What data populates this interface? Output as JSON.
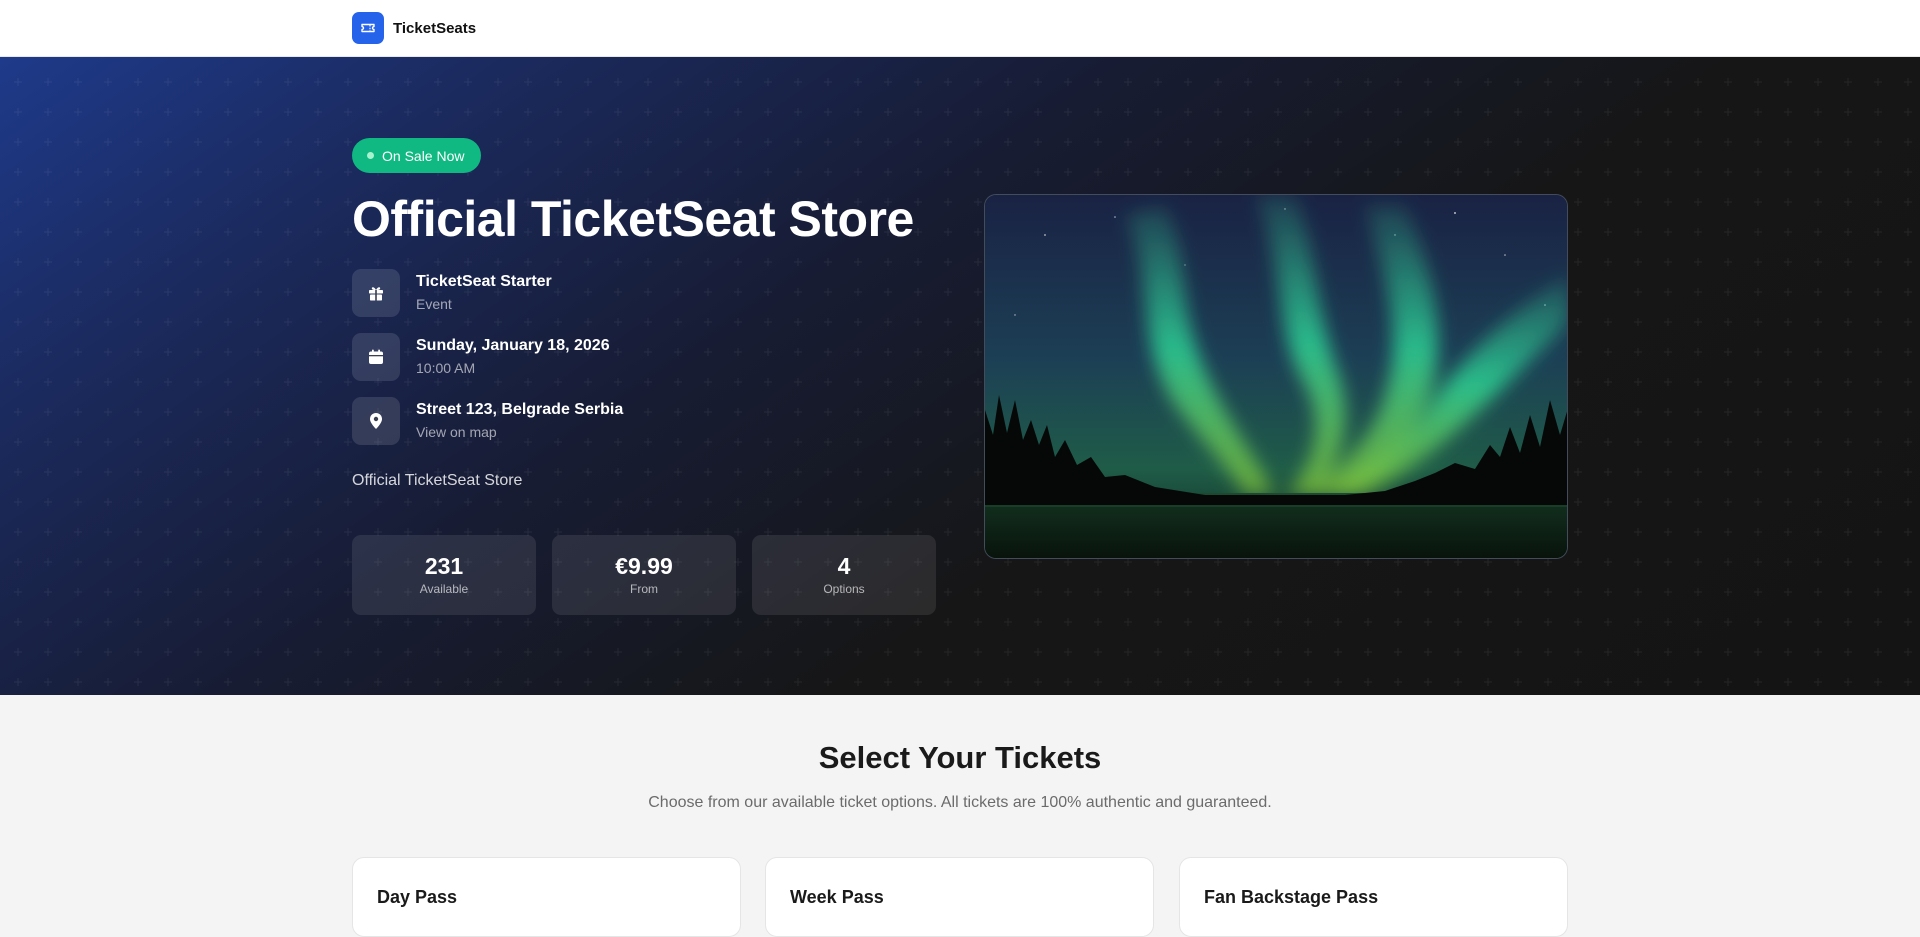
{
  "header": {
    "brand_name": "TicketSeats",
    "logo_icon": "ticket-icon",
    "logo_color": "#2563eb"
  },
  "hero": {
    "badge": "On Sale Now",
    "badge_color": "#10b981",
    "title": "Official TicketSeat Store",
    "info": [
      {
        "icon": "gift-icon",
        "main": "TicketSeat Starter",
        "sub": "Event"
      },
      {
        "icon": "calendar-icon",
        "main": "Sunday, January 18, 2026",
        "sub": "10:00 AM"
      },
      {
        "icon": "location-pin-icon",
        "main": "Street 123, Belgrade Serbia",
        "sub": "View on map"
      }
    ],
    "description": "Official TicketSeat Store",
    "stats": [
      {
        "value": "231",
        "label": "Available"
      },
      {
        "value": "€9.99",
        "label": "From"
      },
      {
        "value": "4",
        "label": "Options"
      }
    ],
    "image": "aurora-borealis-over-forest-lake"
  },
  "tickets": {
    "title": "Select Your Tickets",
    "subtitle": "Choose from our available ticket options. All tickets are 100% authentic and guaranteed.",
    "cards": [
      {
        "name": "Day Pass"
      },
      {
        "name": "Week Pass"
      },
      {
        "name": "Fan Backstage Pass"
      }
    ]
  }
}
